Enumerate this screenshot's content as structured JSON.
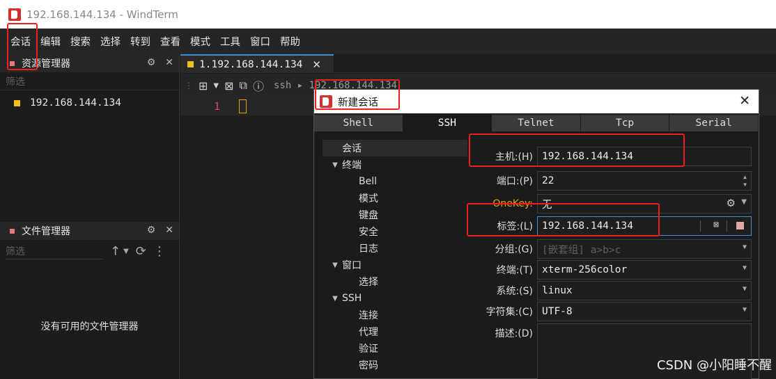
{
  "window": {
    "title": "192.168.144.134 - WindTerm"
  },
  "menu": [
    "会话",
    "编辑",
    "搜索",
    "选择",
    "转到",
    "查看",
    "模式",
    "工具",
    "窗口",
    "帮助"
  ],
  "resource_panel": {
    "title": "资源管理器",
    "filter_placeholder": "筛选",
    "items": [
      "192.168.144.134"
    ]
  },
  "file_panel": {
    "title": "文件管理器",
    "filter_placeholder": "筛选",
    "empty_text": "没有可用的文件管理器"
  },
  "editor": {
    "tab_label": "1.192.168.144.134",
    "path": "ssh  ▸  192.168.144.134",
    "line_number": "1"
  },
  "dialog": {
    "title": "新建会话",
    "tabs": [
      "Shell",
      "SSH",
      "Telnet",
      "Tcp",
      "Serial"
    ],
    "active_tab": "SSH",
    "tree": [
      {
        "label": "会话",
        "level": 0,
        "arrow": ""
      },
      {
        "label": "终端",
        "level": 0,
        "arrow": "▼"
      },
      {
        "label": "Bell",
        "level": 1,
        "arrow": ""
      },
      {
        "label": "模式",
        "level": 1,
        "arrow": ""
      },
      {
        "label": "键盘",
        "level": 1,
        "arrow": ""
      },
      {
        "label": "安全",
        "level": 1,
        "arrow": ""
      },
      {
        "label": "日志",
        "level": 1,
        "arrow": ""
      },
      {
        "label": "窗口",
        "level": 0,
        "arrow": "▼"
      },
      {
        "label": "选择",
        "level": 1,
        "arrow": ""
      },
      {
        "label": "SSH",
        "level": 0,
        "arrow": "▼"
      },
      {
        "label": "连接",
        "level": 1,
        "arrow": ""
      },
      {
        "label": "代理",
        "level": 1,
        "arrow": ""
      },
      {
        "label": "验证",
        "level": 1,
        "arrow": ""
      },
      {
        "label": "密码",
        "level": 1,
        "arrow": ""
      }
    ],
    "fields": {
      "host": {
        "label": "主机:(H)",
        "value": "192.168.144.134"
      },
      "port": {
        "label": "端口:(P)",
        "value": "22"
      },
      "onekey": {
        "label": "OneKey:",
        "value": "无"
      },
      "tag": {
        "label": "标签:(L)",
        "value": "192.168.144.134"
      },
      "group": {
        "label": "分组:(G)",
        "placeholder": "[嵌套组] a>b>c"
      },
      "terminal": {
        "label": "终端:(T)",
        "value": "xterm-256color"
      },
      "system": {
        "label": "系统:(S)",
        "value": "linux"
      },
      "charset": {
        "label": "字符集:(C)",
        "value": "UTF-8"
      },
      "description": {
        "label": "描述:(D)"
      }
    }
  },
  "watermark": "CSDN @小阳睡不醒",
  "colors": {
    "accent": "#3c8fd6",
    "annotation": "#f02020",
    "brand_red": "#d32f2f"
  }
}
